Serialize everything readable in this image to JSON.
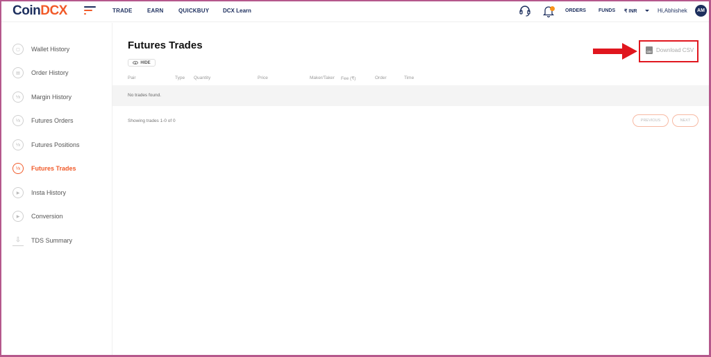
{
  "header": {
    "logo_part1": "Coin",
    "logo_part2": "DCX",
    "nav": [
      "TRADE",
      "EARN",
      "QUICKBUY",
      "DCX Learn"
    ],
    "orders_label": "ORDERS",
    "funds_label": "FUNDS",
    "currency": "₹ INR",
    "greeting": "Hi,Abhishek",
    "avatar_initials": "AM"
  },
  "colors": {
    "brand_navy": "#1d2f5e",
    "brand_orange": "#f15a29",
    "notification_dot": "#f7931a",
    "highlight_red": "#e0161e",
    "frame": "#b5588c"
  },
  "sidebar": {
    "items": [
      {
        "label": "Wallet History",
        "icon": "wallet-icon",
        "glyph": "▢",
        "active": false
      },
      {
        "label": "Order History",
        "icon": "order-icon",
        "glyph": "▤",
        "active": false
      },
      {
        "label": "Margin History",
        "icon": "margin-icon",
        "glyph": "⅟x",
        "active": false
      },
      {
        "label": "Futures Orders",
        "icon": "futures-icon",
        "glyph": "⅟x",
        "active": false
      },
      {
        "label": "Futures Positions",
        "icon": "futures-icon",
        "glyph": "⅟x",
        "active": false
      },
      {
        "label": "Futures Trades",
        "icon": "futures-icon",
        "glyph": "⅟x",
        "active": true
      },
      {
        "label": "Insta History",
        "icon": "insta-icon",
        "glyph": "▶",
        "active": false
      },
      {
        "label": "Conversion",
        "icon": "conversion-icon",
        "glyph": "▶",
        "active": false
      },
      {
        "label": "TDS Summary",
        "icon": "download-icon",
        "glyph": "⇩",
        "active": false
      }
    ]
  },
  "main": {
    "title": "Futures Trades",
    "hide_label": "HIDE",
    "columns": [
      "Pair",
      "Type",
      "Quantity",
      "Price",
      "Maker/Taker",
      "Fee (₹)",
      "Order",
      "Time"
    ],
    "empty_message": "No trades found.",
    "showing_text": "Showing trades 1-0 of 0",
    "previous_label": "PREVIOUS",
    "next_label": "NEXT",
    "download_label": "Download CSV",
    "download_icon_text": "CSV"
  }
}
